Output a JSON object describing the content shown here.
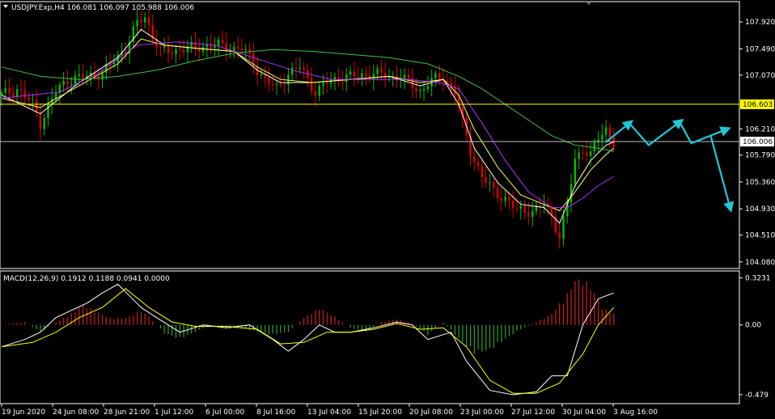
{
  "header": {
    "symbol_line": "USDJPY.Exp,H4  106.081 106.097 105.988 106.006",
    "macd_line": "MACD(12,26,9) 0.1912 0.1188 0.0941 0.0000"
  },
  "colors": {
    "background": "#000000",
    "frame": "#ffffff",
    "bull_candle": "#00c000",
    "bear_candle": "#e00000",
    "ma_fast": "#ffffe0",
    "ma_mid": "#ffff60",
    "ma_purple": "#b030ff",
    "ma_green": "#40c040",
    "level_line": "#ffff00",
    "price_line": "#c0c0c0",
    "arrows": "#20c8d8",
    "macd_hist_pos": "#d02020",
    "macd_hist_neg": "#30a030",
    "macd_line": "#ffffff",
    "signal_line": "#ffff00"
  },
  "chart_data": [
    {
      "type": "candlestick",
      "x_tick_labels": [
        "19 Jun 2020",
        "24 Jun 08:00",
        "28 Jun 21:00",
        "1 Jul 12:00",
        "6 Jul 00:00",
        "8 Jul 16:00",
        "13 Jul 04:00",
        "15 Jul 20:00",
        "20 Jul 08:00",
        "23 Jul 00:00",
        "27 Jul 12:00",
        "30 Jul 04:00",
        "3 Aug 16:00"
      ],
      "y_tick_labels": [
        "107.920",
        "107.490",
        "107.070",
        "106.210",
        "105.790",
        "105.360",
        "104.930",
        "104.510",
        "104.080"
      ],
      "ylim": [
        104.0,
        108.22
      ],
      "horizontal_level": {
        "value": 106.603,
        "label": "106.603"
      },
      "current_price": {
        "value": 106.006,
        "label": "106.006"
      },
      "close_path": [
        [
          0,
          106.75
        ],
        [
          4,
          106.85
        ],
        [
          8,
          106.6
        ],
        [
          10,
          106.3
        ],
        [
          14,
          106.8
        ],
        [
          17,
          107.0
        ],
        [
          22,
          107.05
        ],
        [
          26,
          107.1
        ],
        [
          29,
          107.3
        ],
        [
          32,
          107.5
        ],
        [
          35,
          107.9
        ],
        [
          37,
          108.0
        ],
        [
          39,
          107.7
        ],
        [
          41,
          107.45
        ],
        [
          44,
          107.45
        ],
        [
          47,
          107.5
        ],
        [
          50,
          107.5
        ],
        [
          53,
          107.55
        ],
        [
          56,
          107.55
        ],
        [
          60,
          107.5
        ],
        [
          62,
          107.5
        ],
        [
          64,
          107.35
        ],
        [
          66,
          107.15
        ],
        [
          68,
          107.0
        ],
        [
          71,
          106.85
        ],
        [
          74,
          107.1
        ],
        [
          77,
          107.2
        ],
        [
          79,
          107.0
        ],
        [
          81,
          106.8
        ],
        [
          84,
          106.95
        ],
        [
          88,
          107.05
        ],
        [
          92,
          107.05
        ],
        [
          96,
          107.1
        ],
        [
          100,
          107.05
        ],
        [
          103,
          107.05
        ],
        [
          106,
          106.9
        ],
        [
          108,
          106.8
        ],
        [
          110,
          106.95
        ],
        [
          114,
          107.05
        ],
        [
          117,
          106.8
        ],
        [
          119,
          106.3
        ],
        [
          121,
          105.85
        ],
        [
          124,
          105.45
        ],
        [
          127,
          105.2
        ],
        [
          130,
          105.1
        ],
        [
          133,
          104.9
        ],
        [
          137,
          104.9
        ],
        [
          140,
          105.0
        ],
        [
          142,
          104.8
        ],
        [
          144,
          104.5
        ],
        [
          146,
          105.0
        ],
        [
          148,
          105.7
        ],
        [
          150,
          105.9
        ],
        [
          152,
          105.8
        ],
        [
          154,
          106.05
        ],
        [
          156,
          106.2
        ],
        [
          158,
          106.0
        ]
      ],
      "moving_averages": [
        {
          "role": "fast",
          "points": [
            [
              0,
              106.75
            ],
            [
              10,
              106.45
            ],
            [
              20,
              106.95
            ],
            [
              30,
              107.35
            ],
            [
              36,
              107.8
            ],
            [
              42,
              107.55
            ],
            [
              50,
              107.5
            ],
            [
              60,
              107.45
            ],
            [
              66,
              107.15
            ],
            [
              72,
              106.95
            ],
            [
              80,
              106.95
            ],
            [
              90,
              107.0
            ],
            [
              100,
              107.05
            ],
            [
              108,
              106.9
            ],
            [
              114,
              107.0
            ],
            [
              118,
              106.6
            ],
            [
              122,
              105.9
            ],
            [
              128,
              105.35
            ],
            [
              134,
              105.0
            ],
            [
              140,
              104.95
            ],
            [
              144,
              104.7
            ],
            [
              148,
              105.3
            ],
            [
              152,
              105.7
            ],
            [
              156,
              105.95
            ],
            [
              158,
              106.0
            ]
          ]
        },
        {
          "role": "mid",
          "points": [
            [
              0,
              106.7
            ],
            [
              10,
              106.55
            ],
            [
              20,
              106.9
            ],
            [
              30,
              107.25
            ],
            [
              36,
              107.65
            ],
            [
              42,
              107.55
            ],
            [
              50,
              107.5
            ],
            [
              60,
              107.45
            ],
            [
              66,
              107.2
            ],
            [
              72,
              107.0
            ],
            [
              80,
              106.95
            ],
            [
              90,
              107.0
            ],
            [
              100,
              107.05
            ],
            [
              108,
              106.95
            ],
            [
              114,
              107.0
            ],
            [
              118,
              106.75
            ],
            [
              122,
              106.2
            ],
            [
              128,
              105.6
            ],
            [
              134,
              105.15
            ],
            [
              140,
              105.0
            ],
            [
              144,
              104.9
            ],
            [
              148,
              105.2
            ],
            [
              152,
              105.55
            ],
            [
              156,
              105.8
            ],
            [
              158,
              105.9
            ]
          ]
        },
        {
          "role": "purple",
          "points": [
            [
              0,
              106.7
            ],
            [
              15,
              106.8
            ],
            [
              25,
              107.1
            ],
            [
              35,
              107.55
            ],
            [
              45,
              107.6
            ],
            [
              55,
              107.55
            ],
            [
              65,
              107.35
            ],
            [
              75,
              107.15
            ],
            [
              85,
              107.0
            ],
            [
              95,
              107.0
            ],
            [
              105,
              107.0
            ],
            [
              113,
              106.95
            ],
            [
              118,
              106.85
            ],
            [
              124,
              106.3
            ],
            [
              130,
              105.7
            ],
            [
              136,
              105.2
            ],
            [
              142,
              104.95
            ],
            [
              146,
              104.95
            ],
            [
              150,
              105.1
            ],
            [
              154,
              105.3
            ],
            [
              158,
              105.45
            ]
          ]
        },
        {
          "role": "green",
          "points": [
            [
              0,
              107.2
            ],
            [
              10,
              107.05
            ],
            [
              20,
              107.0
            ],
            [
              30,
              107.05
            ],
            [
              40,
              107.15
            ],
            [
              50,
              107.3
            ],
            [
              60,
              107.42
            ],
            [
              70,
              107.48
            ],
            [
              80,
              107.45
            ],
            [
              90,
              107.4
            ],
            [
              100,
              107.35
            ],
            [
              110,
              107.25
            ],
            [
              118,
              107.05
            ],
            [
              124,
              106.85
            ],
            [
              130,
              106.6
            ],
            [
              136,
              106.35
            ],
            [
              142,
              106.1
            ],
            [
              148,
              105.95
            ],
            [
              154,
              105.9
            ],
            [
              158,
              105.85
            ]
          ]
        }
      ],
      "forecast_arrows": [
        [
          [
            156,
            106.0
          ],
          [
            162,
            106.3
          ],
          [
            167,
            105.95
          ],
          [
            175,
            106.32
          ],
          [
            178,
            105.98
          ],
          [
            187,
            106.2
          ]
        ],
        [
          [
            183,
            106.1
          ],
          [
            188,
            104.95
          ]
        ]
      ]
    },
    {
      "type": "macd",
      "title": "MACD(12,26,9) 0.1912 0.1188 0.0941 0.0000",
      "y_tick_labels": [
        "0.3231",
        "0.00",
        "-0.479"
      ],
      "ylim": [
        -0.53,
        0.36
      ],
      "histogram_points": [
        [
          0,
          0.0
        ],
        [
          6,
          0.02
        ],
        [
          10,
          -0.05
        ],
        [
          14,
          0.02
        ],
        [
          18,
          0.08
        ],
        [
          21,
          0.15
        ],
        [
          24,
          0.1
        ],
        [
          28,
          0.05
        ],
        [
          32,
          0.05
        ],
        [
          36,
          0.1
        ],
        [
          38,
          0.06
        ],
        [
          42,
          -0.06
        ],
        [
          46,
          -0.1
        ],
        [
          50,
          -0.05
        ],
        [
          54,
          0.0
        ],
        [
          58,
          -0.03
        ],
        [
          62,
          -0.02
        ],
        [
          66,
          -0.05
        ],
        [
          70,
          -0.07
        ],
        [
          74,
          -0.05
        ],
        [
          78,
          0.05
        ],
        [
          82,
          0.12
        ],
        [
          86,
          0.06
        ],
        [
          90,
          -0.02
        ],
        [
          94,
          -0.05
        ],
        [
          98,
          0.02
        ],
        [
          102,
          0.04
        ],
        [
          106,
          0.01
        ],
        [
          110,
          -0.07
        ],
        [
          114,
          0.02
        ],
        [
          118,
          -0.1
        ],
        [
          122,
          -0.2
        ],
        [
          126,
          -0.18
        ],
        [
          130,
          -0.1
        ],
        [
          134,
          -0.03
        ],
        [
          138,
          0.02
        ],
        [
          142,
          0.08
        ],
        [
          146,
          0.22
        ],
        [
          148,
          0.32
        ],
        [
          150,
          0.32
        ],
        [
          152,
          0.28
        ],
        [
          155,
          0.12
        ],
        [
          158,
          0.08
        ]
      ],
      "macd_line": [
        [
          0,
          -0.15
        ],
        [
          6,
          -0.1
        ],
        [
          10,
          -0.05
        ],
        [
          14,
          0.05
        ],
        [
          18,
          0.1
        ],
        [
          22,
          0.15
        ],
        [
          26,
          0.22
        ],
        [
          30,
          0.28
        ],
        [
          33,
          0.2
        ],
        [
          36,
          0.12
        ],
        [
          40,
          0.05
        ],
        [
          46,
          -0.05
        ],
        [
          52,
          0.0
        ],
        [
          58,
          -0.02
        ],
        [
          64,
          0.0
        ],
        [
          70,
          -0.1
        ],
        [
          74,
          -0.18
        ],
        [
          78,
          -0.1
        ],
        [
          82,
          0.0
        ],
        [
          86,
          -0.05
        ],
        [
          90,
          -0.05
        ],
        [
          96,
          -0.02
        ],
        [
          102,
          0.02
        ],
        [
          106,
          0.0
        ],
        [
          110,
          -0.1
        ],
        [
          116,
          -0.05
        ],
        [
          120,
          -0.25
        ],
        [
          126,
          -0.45
        ],
        [
          132,
          -0.48
        ],
        [
          138,
          -0.46
        ],
        [
          142,
          -0.35
        ],
        [
          146,
          -0.35
        ],
        [
          150,
          0.0
        ],
        [
          154,
          0.18
        ],
        [
          158,
          0.22
        ]
      ],
      "signal_line": [
        [
          0,
          -0.15
        ],
        [
          8,
          -0.12
        ],
        [
          14,
          -0.05
        ],
        [
          20,
          0.05
        ],
        [
          26,
          0.12
        ],
        [
          32,
          0.25
        ],
        [
          38,
          0.12
        ],
        [
          44,
          0.02
        ],
        [
          50,
          -0.01
        ],
        [
          58,
          -0.01
        ],
        [
          66,
          -0.03
        ],
        [
          72,
          -0.13
        ],
        [
          78,
          -0.12
        ],
        [
          84,
          -0.05
        ],
        [
          90,
          -0.05
        ],
        [
          96,
          -0.03
        ],
        [
          102,
          0.01
        ],
        [
          108,
          -0.03
        ],
        [
          114,
          -0.02
        ],
        [
          120,
          -0.15
        ],
        [
          126,
          -0.38
        ],
        [
          132,
          -0.47
        ],
        [
          138,
          -0.47
        ],
        [
          144,
          -0.4
        ],
        [
          150,
          -0.2
        ],
        [
          154,
          0.0
        ],
        [
          158,
          0.12
        ]
      ]
    }
  ]
}
